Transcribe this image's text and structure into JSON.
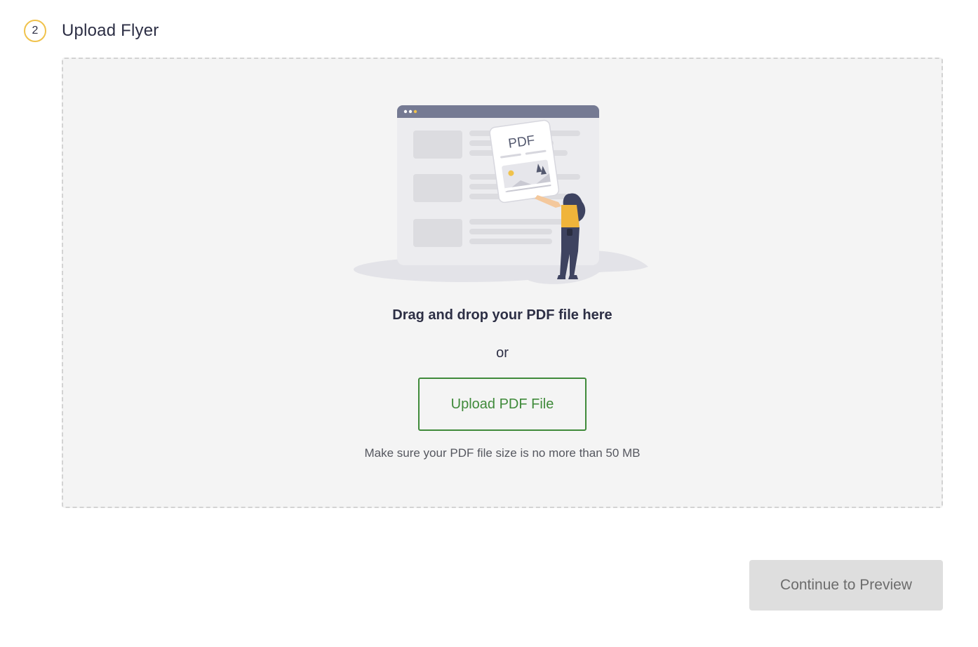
{
  "step": {
    "number": "2",
    "title": "Upload Flyer"
  },
  "dropzone": {
    "illustration_label": "PDF",
    "drag_text": "Drag and drop your PDF file here",
    "or_text": "or",
    "upload_button_label": "Upload PDF File",
    "hint_text": "Make sure your PDF file size is no more than 50 MB"
  },
  "footer": {
    "continue_button_label": "Continue to Preview",
    "continue_button_disabled": true
  },
  "colors": {
    "accent_green": "#3f8a3a",
    "step_badge_ring": "#f0c24b",
    "dropzone_bg": "#f4f4f4",
    "disabled_button_bg": "#dedede",
    "text_dark": "#2d2f45"
  },
  "icons": {
    "illustration": "pdf-upload-illustration-icon"
  }
}
